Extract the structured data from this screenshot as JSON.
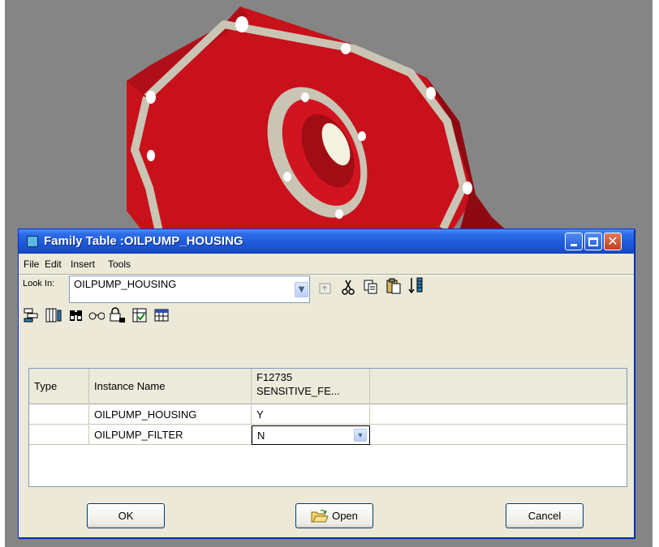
{
  "window": {
    "title": "Family Table :OILPUMP_HOUSING"
  },
  "menu": [
    "File",
    "Edit",
    "Insert",
    "Tools"
  ],
  "lookin": {
    "label": "Look In:",
    "value": "OILPUMP_HOUSING"
  },
  "toolbar1_icons": [
    "up-folder-icon",
    "cut-icon",
    "copy-icon",
    "paste-icon",
    "sort-icon"
  ],
  "toolbar2_icons": [
    "add-column-icon",
    "add-row-icon",
    "find-icon",
    "preview-icon",
    "lock-icon",
    "verify-icon",
    "table-icon"
  ],
  "table": {
    "headers": {
      "type": "Type",
      "instance": "Instance Name",
      "param_line1": "F12735",
      "param_line2": "SENSITIVE_FE..."
    },
    "rows": [
      {
        "type": "",
        "instance": "OILPUMP_HOUSING",
        "value": "Y"
      },
      {
        "type": "",
        "instance": "OILPUMP_FILTER",
        "value": "N"
      }
    ]
  },
  "buttons": {
    "ok": "OK",
    "open": "Open",
    "cancel": "Cancel"
  },
  "colors": {
    "titlebar": "#1d5ad9",
    "dialog_bg": "#ece9d8",
    "part_red": "#c8111b",
    "viewport_gray": "#858585"
  }
}
